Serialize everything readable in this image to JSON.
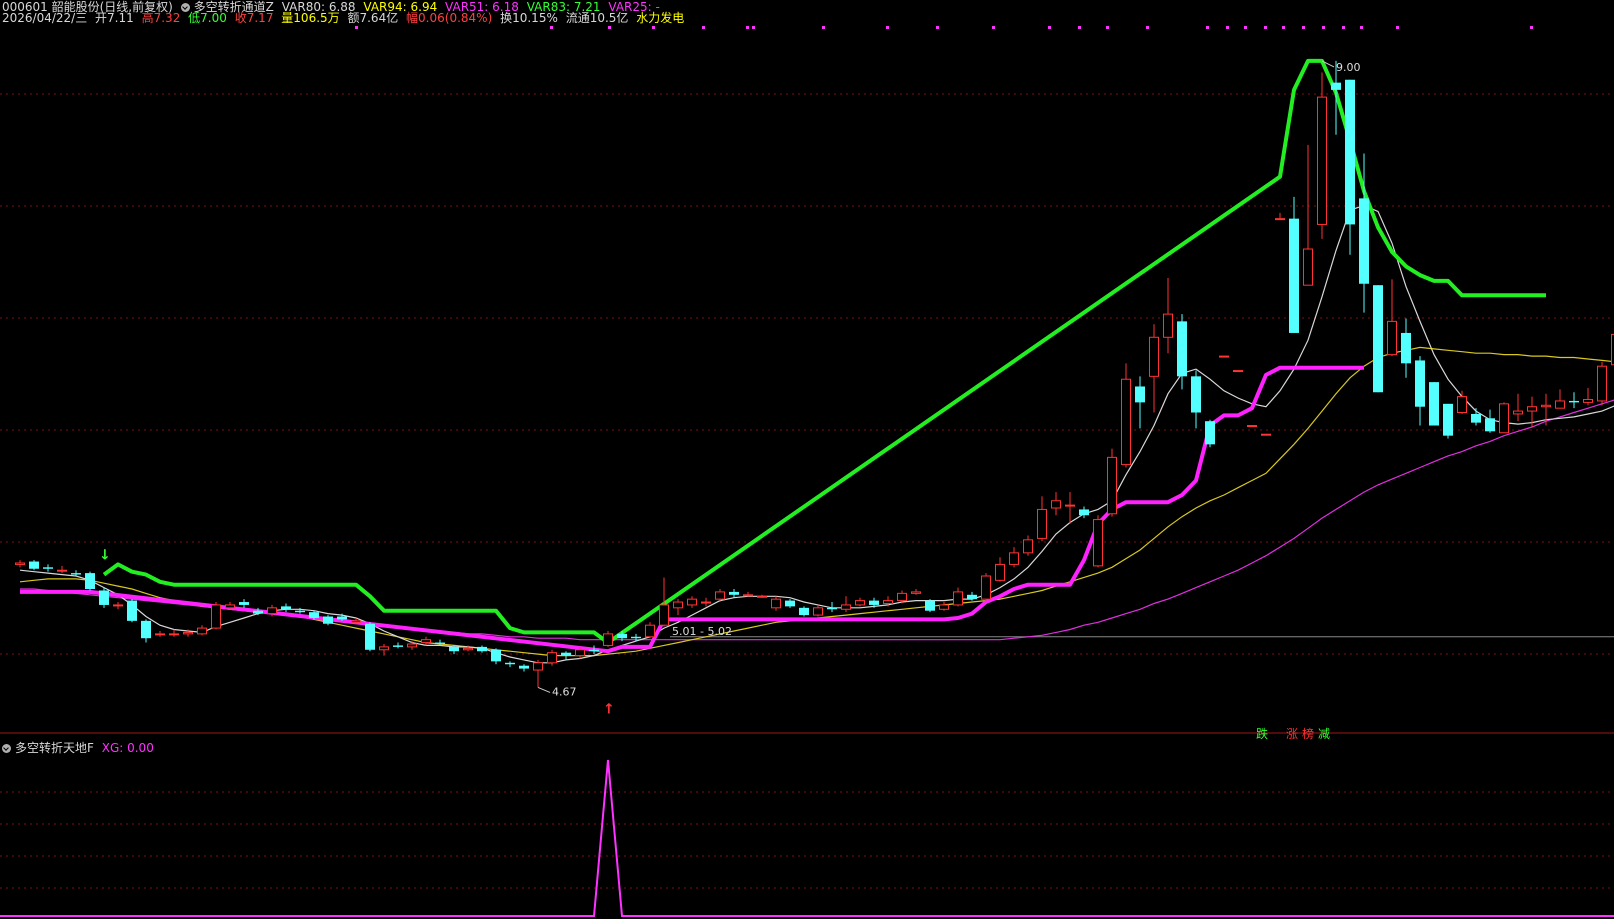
{
  "header": {
    "line1": {
      "stock": "000601 韶能股份(日线,前复权)",
      "indicator_name": "多空转折通道Z",
      "var80": "VAR80: 6.88",
      "var94": "VAR94: 6.94",
      "var51": "VAR51: 6.18",
      "var83": "VAR83: 7.21",
      "var25": "VAR25: -"
    },
    "line2": {
      "date": "2026/04/22/三",
      "open": "开7.11",
      "high": "高7.32",
      "low": "低7.00",
      "close": "收7.17",
      "volume": "量106.5万",
      "amount": "额7.64亿",
      "change": "幅0.06(0.84%)",
      "turnover": "换10.15%",
      "float_cap": "流通10.5亿",
      "concept": "水力发电"
    }
  },
  "sub_header": {
    "indicator_name": "多空转折天地F",
    "xg": "XG: 0.00"
  },
  "annotations": {
    "high_label": "9.00",
    "low_label": "4.67",
    "range_label": "5.01 - 5.02",
    "tag_fall": "跌",
    "tag_up": "涨",
    "tag_list": "榜",
    "tag_cut": "减"
  },
  "chart_data": {
    "type": "candlestick",
    "ylim": [
      4.5,
      9.2
    ],
    "colors": {
      "up": "#ff3333",
      "down": "#54ffff",
      "ma_white": "#d8d8d8",
      "ma_yellow": "#d8c820",
      "ma_magenta": "#e030e0",
      "channel_green": "#22ee22",
      "channel_magenta": "#ff22ff",
      "grid": "#7a1010"
    },
    "candles": [
      [
        5.52,
        5.53,
        5.55,
        5.5
      ],
      [
        5.54,
        5.49,
        5.55,
        5.48
      ],
      [
        5.5,
        5.49,
        5.52,
        5.47
      ],
      [
        5.48,
        5.48,
        5.51,
        5.46
      ],
      [
        5.46,
        5.45,
        5.48,
        5.44
      ],
      [
        5.46,
        5.35,
        5.47,
        5.34
      ],
      [
        5.34,
        5.24,
        5.36,
        5.22
      ],
      [
        5.24,
        5.24,
        5.26,
        5.21
      ],
      [
        5.27,
        5.13,
        5.28,
        5.12
      ],
      [
        5.13,
        5.01,
        5.14,
        4.98
      ],
      [
        5.04,
        5.04,
        5.06,
        5.02
      ],
      [
        5.04,
        5.04,
        5.07,
        5.02
      ],
      [
        5.04,
        5.05,
        5.07,
        5.02
      ],
      [
        5.04,
        5.08,
        5.1,
        5.03
      ],
      [
        5.08,
        5.24,
        5.26,
        5.07
      ],
      [
        5.22,
        5.24,
        5.26,
        5.21
      ],
      [
        5.26,
        5.24,
        5.28,
        5.22
      ],
      [
        5.2,
        5.18,
        5.22,
        5.17
      ],
      [
        5.18,
        5.22,
        5.24,
        5.16
      ],
      [
        5.23,
        5.21,
        5.25,
        5.19
      ],
      [
        5.2,
        5.19,
        5.22,
        5.18
      ],
      [
        5.19,
        5.15,
        5.2,
        5.14
      ],
      [
        5.16,
        5.11,
        5.17,
        5.1
      ],
      [
        5.16,
        5.14,
        5.18,
        5.13
      ],
      [
        5.12,
        5.13,
        5.15,
        5.11
      ],
      [
        5.11,
        4.93,
        5.12,
        4.92
      ],
      [
        4.93,
        4.95,
        4.97,
        4.89
      ],
      [
        4.96,
        4.95,
        4.98,
        4.94
      ],
      [
        4.95,
        4.97,
        4.99,
        4.93
      ],
      [
        4.98,
        5.0,
        5.02,
        4.96
      ],
      [
        4.98,
        4.97,
        5.0,
        4.96
      ],
      [
        4.95,
        4.92,
        4.96,
        4.9
      ],
      [
        4.93,
        4.94,
        4.96,
        4.92
      ],
      [
        4.95,
        4.92,
        4.96,
        4.91
      ],
      [
        4.93,
        4.85,
        4.94,
        4.83
      ],
      [
        4.84,
        4.83,
        4.85,
        4.81
      ],
      [
        4.82,
        4.8,
        4.83,
        4.78
      ],
      [
        4.79,
        4.84,
        4.86,
        4.67
      ],
      [
        4.84,
        4.91,
        4.93,
        4.82
      ],
      [
        4.91,
        4.89,
        4.92,
        4.86
      ],
      [
        4.89,
        4.93,
        4.95,
        4.87
      ],
      [
        4.93,
        4.92,
        4.96,
        4.9
      ],
      [
        4.96,
        5.04,
        5.06,
        4.95
      ],
      [
        5.04,
        5.01,
        5.06,
        4.99
      ],
      [
        5.02,
        5.01,
        5.04,
        4.99
      ],
      [
        5.02,
        5.1,
        5.12,
        5.01
      ],
      [
        5.1,
        5.24,
        5.43,
        5.09
      ],
      [
        5.22,
        5.26,
        5.28,
        5.17
      ],
      [
        5.24,
        5.28,
        5.3,
        5.22
      ],
      [
        5.26,
        5.26,
        5.29,
        5.23
      ],
      [
        5.28,
        5.33,
        5.35,
        5.26
      ],
      [
        5.33,
        5.31,
        5.35,
        5.29
      ],
      [
        5.31,
        5.31,
        5.33,
        5.3
      ],
      [
        5.3,
        5.3,
        5.31,
        5.29
      ],
      [
        5.22,
        5.28,
        5.3,
        5.2
      ],
      [
        5.27,
        5.23,
        5.28,
        5.22
      ],
      [
        5.22,
        5.17,
        5.23,
        5.16
      ],
      [
        5.17,
        5.22,
        5.24,
        5.16
      ],
      [
        5.22,
        5.21,
        5.26,
        5.19
      ],
      [
        5.21,
        5.24,
        5.3,
        5.19
      ],
      [
        5.24,
        5.27,
        5.29,
        5.23
      ],
      [
        5.27,
        5.24,
        5.29,
        5.22
      ],
      [
        5.25,
        5.27,
        5.3,
        5.23
      ],
      [
        5.27,
        5.32,
        5.34,
        5.25
      ],
      [
        5.32,
        5.33,
        5.35,
        5.31
      ],
      [
        5.27,
        5.2,
        5.28,
        5.19
      ],
      [
        5.21,
        5.24,
        5.26,
        5.2
      ],
      [
        5.24,
        5.33,
        5.36,
        5.23
      ],
      [
        5.31,
        5.28,
        5.33,
        5.27
      ],
      [
        5.28,
        5.44,
        5.46,
        5.27
      ],
      [
        5.41,
        5.52,
        5.57,
        5.4
      ],
      [
        5.52,
        5.6,
        5.64,
        5.5
      ],
      [
        5.6,
        5.69,
        5.72,
        5.58
      ],
      [
        5.7,
        5.9,
        5.99,
        5.68
      ],
      [
        5.91,
        5.96,
        6.02,
        5.86
      ],
      [
        5.93,
        5.93,
        6.02,
        5.8
      ],
      [
        5.9,
        5.86,
        5.92,
        5.84
      ],
      [
        5.51,
        5.83,
        5.86,
        5.5
      ],
      [
        5.87,
        6.26,
        6.32,
        5.85
      ],
      [
        6.21,
        6.8,
        6.91,
        6.19
      ],
      [
        6.75,
        6.64,
        6.82,
        6.46
      ],
      [
        6.82,
        7.09,
        7.18,
        6.57
      ],
      [
        7.09,
        7.25,
        7.5,
        6.98
      ],
      [
        7.2,
        6.82,
        7.25,
        6.73
      ],
      [
        6.82,
        6.57,
        6.86,
        6.46
      ],
      [
        6.51,
        6.35,
        6.52,
        6.33
      ],
      [
        6.96,
        6.96,
        6.96,
        6.96
      ],
      [
        6.86,
        6.86,
        6.86,
        6.86
      ],
      [
        6.48,
        6.48,
        6.48,
        6.48
      ],
      [
        6.42,
        6.42,
        6.42,
        6.42
      ],
      [
        7.91,
        7.91,
        7.95,
        7.91
      ],
      [
        7.91,
        7.12,
        8.06,
        7.12
      ],
      [
        7.45,
        7.7,
        8.42,
        7.45
      ],
      [
        7.87,
        8.75,
        8.92,
        7.77
      ],
      [
        8.85,
        8.8,
        9.0,
        8.49
      ],
      [
        8.87,
        7.87,
        8.87,
        7.66
      ],
      [
        8.05,
        7.46,
        8.36,
        7.26
      ],
      [
        7.45,
        6.71,
        7.45,
        6.71
      ],
      [
        6.97,
        7.2,
        7.49,
        6.96
      ],
      [
        7.12,
        6.91,
        7.22,
        6.81
      ],
      [
        6.93,
        6.61,
        6.96,
        6.48
      ],
      [
        6.78,
        6.48,
        6.78,
        6.48
      ],
      [
        6.63,
        6.41,
        6.63,
        6.39
      ],
      [
        6.57,
        6.68,
        6.72,
        6.56
      ],
      [
        6.56,
        6.5,
        6.6,
        6.48
      ],
      [
        6.53,
        6.44,
        6.59,
        6.43
      ],
      [
        6.43,
        6.63,
        6.64,
        6.43
      ],
      [
        6.56,
        6.58,
        6.7,
        6.51
      ],
      [
        6.58,
        6.61,
        6.68,
        6.47
      ],
      [
        6.61,
        6.62,
        6.7,
        6.48
      ],
      [
        6.6,
        6.65,
        6.73,
        6.6
      ],
      [
        6.65,
        6.64,
        6.71,
        6.6
      ],
      [
        6.64,
        6.66,
        6.74,
        6.62
      ],
      [
        6.65,
        6.89,
        6.92,
        6.62
      ],
      [
        6.9,
        7.11,
        7.26,
        6.79
      ],
      [
        7.11,
        7.17,
        7.32,
        7.0
      ]
    ],
    "ma_white": [
      5.48,
      5.47,
      5.46,
      5.45,
      5.44,
      5.41,
      5.36,
      5.31,
      5.24,
      5.16,
      5.1,
      5.07,
      5.06,
      5.05,
      5.09,
      5.12,
      5.15,
      5.18,
      5.2,
      5.21,
      5.21,
      5.2,
      5.18,
      5.17,
      5.15,
      5.11,
      5.06,
      5.02,
      4.98,
      4.96,
      4.96,
      4.95,
      4.95,
      4.94,
      4.91,
      4.88,
      4.86,
      4.84,
      4.84,
      4.86,
      4.87,
      4.89,
      4.93,
      4.96,
      4.99,
      5.02,
      5.08,
      5.12,
      5.17,
      5.22,
      5.27,
      5.29,
      5.3,
      5.3,
      5.3,
      5.29,
      5.26,
      5.24,
      5.22,
      5.22,
      5.22,
      5.23,
      5.24,
      5.26,
      5.27,
      5.27,
      5.27,
      5.28,
      5.28,
      5.31,
      5.36,
      5.42,
      5.5,
      5.61,
      5.73,
      5.81,
      5.87,
      5.9,
      5.96,
      6.14,
      6.3,
      6.48,
      6.7,
      6.84,
      6.87,
      6.8,
      6.72,
      6.67,
      6.63,
      6.61,
      6.72,
      6.87,
      7.07,
      7.37,
      7.69,
      7.97,
      8.0,
      7.96,
      7.74,
      7.44,
      7.2,
      6.97,
      6.8,
      6.68,
      6.58,
      6.52,
      6.5,
      6.49,
      6.5,
      6.52,
      6.53,
      6.54,
      6.56,
      6.58,
      6.62,
      6.69,
      6.78
    ],
    "ma_yellow": [
      5.4,
      5.41,
      5.42,
      5.42,
      5.42,
      5.41,
      5.39,
      5.37,
      5.35,
      5.32,
      5.29,
      5.27,
      5.25,
      5.23,
      5.22,
      5.21,
      5.2,
      5.19,
      5.18,
      5.17,
      5.16,
      5.14,
      5.12,
      5.1,
      5.08,
      5.06,
      5.04,
      5.02,
      5.0,
      4.98,
      4.97,
      4.96,
      4.95,
      4.94,
      4.93,
      4.92,
      4.91,
      4.9,
      4.89,
      4.89,
      4.89,
      4.89,
      4.9,
      4.91,
      4.92,
      4.94,
      4.96,
      4.98,
      5.0,
      5.02,
      5.04,
      5.06,
      5.08,
      5.1,
      5.12,
      5.13,
      5.14,
      5.15,
      5.16,
      5.17,
      5.18,
      5.19,
      5.2,
      5.21,
      5.22,
      5.23,
      5.24,
      5.25,
      5.26,
      5.27,
      5.28,
      5.3,
      5.32,
      5.34,
      5.37,
      5.4,
      5.43,
      5.46,
      5.5,
      5.56,
      5.62,
      5.7,
      5.78,
      5.85,
      5.91,
      5.96,
      6.0,
      6.05,
      6.1,
      6.15,
      6.25,
      6.35,
      6.46,
      6.58,
      6.7,
      6.81,
      6.89,
      6.95,
      6.98,
      7.0,
      7.02,
      7.01,
      7.0,
      6.99,
      6.98,
      6.98,
      6.97,
      6.97,
      6.96,
      6.96,
      6.95,
      6.95,
      6.94,
      6.93,
      6.92,
      6.9,
      6.88
    ],
    "ma_magenta": [
      5.35,
      5.35,
      5.34,
      5.33,
      5.32,
      5.31,
      5.3,
      5.29,
      5.28,
      5.27,
      5.26,
      5.25,
      5.24,
      5.23,
      5.22,
      5.21,
      5.2,
      5.19,
      5.18,
      5.17,
      5.16,
      5.15,
      5.14,
      5.13,
      5.12,
      5.11,
      5.1,
      5.09,
      5.08,
      5.07,
      5.06,
      5.05,
      5.04,
      5.04,
      5.03,
      5.02,
      5.02,
      5.01,
      5.01,
      5.01,
      5.0,
      5.0,
      5.0,
      5.0,
      5.0,
      5.0,
      5.0,
      5.0,
      5.0,
      5.0,
      5.0,
      5.0,
      5.0,
      5.0,
      5.0,
      5.0,
      5.0,
      5.0,
      5.0,
      5.0,
      5.0,
      5.0,
      5.0,
      5.0,
      5.0,
      5.0,
      5.0,
      5.0,
      5.0,
      5.0,
      5.0,
      5.01,
      5.02,
      5.03,
      5.05,
      5.07,
      5.1,
      5.12,
      5.15,
      5.18,
      5.21,
      5.25,
      5.28,
      5.32,
      5.36,
      5.4,
      5.44,
      5.48,
      5.53,
      5.58,
      5.64,
      5.7,
      5.77,
      5.84,
      5.9,
      5.96,
      6.02,
      6.07,
      6.11,
      6.15,
      6.19,
      6.23,
      6.27,
      6.3,
      6.34,
      6.37,
      6.41,
      6.44,
      6.47,
      6.51,
      6.54,
      6.57,
      6.6,
      6.63,
      6.66,
      6.7,
      6.73
    ],
    "channel_green": [
      [
        6,
        5.45
      ],
      [
        7,
        5.52
      ],
      [
        8,
        5.47
      ],
      [
        9,
        5.45
      ],
      [
        10,
        5.4
      ],
      [
        11,
        5.38
      ],
      [
        12,
        5.38
      ],
      [
        13,
        5.38
      ],
      [
        14,
        5.38
      ],
      [
        15,
        5.38
      ],
      [
        16,
        5.38
      ],
      [
        17,
        5.38
      ],
      [
        18,
        5.38
      ],
      [
        19,
        5.38
      ],
      [
        20,
        5.38
      ],
      [
        21,
        5.38
      ],
      [
        22,
        5.38
      ],
      [
        23,
        5.38
      ],
      [
        24,
        5.38
      ],
      [
        25,
        5.3
      ],
      [
        26,
        5.2
      ],
      [
        27,
        5.2
      ],
      [
        28,
        5.2
      ],
      [
        29,
        5.2
      ],
      [
        30,
        5.2
      ],
      [
        31,
        5.2
      ],
      [
        32,
        5.2
      ],
      [
        33,
        5.2
      ],
      [
        34,
        5.2
      ],
      [
        35,
        5.08
      ],
      [
        36,
        5.05
      ],
      [
        37,
        5.05
      ],
      [
        38,
        5.05
      ],
      [
        39,
        5.05
      ],
      [
        40,
        5.05
      ],
      [
        41,
        5.05
      ],
      [
        42,
        4.98
      ],
      [
        90,
        8.2
      ],
      [
        91,
        8.8
      ],
      [
        92,
        9.0
      ],
      [
        93,
        9.0
      ],
      [
        94,
        8.78
      ],
      [
        95,
        8.45
      ],
      [
        96,
        8.1
      ],
      [
        97,
        7.85
      ],
      [
        98,
        7.68
      ],
      [
        99,
        7.58
      ],
      [
        100,
        7.52
      ],
      [
        101,
        7.48
      ],
      [
        102,
        7.48
      ],
      [
        103,
        7.38
      ],
      [
        104,
        7.38
      ],
      [
        105,
        7.38
      ],
      [
        106,
        7.38
      ],
      [
        107,
        7.38
      ],
      [
        108,
        7.38
      ],
      [
        109,
        7.38
      ]
    ],
    "channel_magenta": [
      [
        0,
        5.33
      ],
      [
        1,
        5.33
      ],
      [
        2,
        5.33
      ],
      [
        3,
        5.33
      ],
      [
        4,
        5.33
      ],
      [
        5,
        5.33
      ],
      [
        42,
        4.92
      ],
      [
        43,
        4.95
      ],
      [
        44,
        4.95
      ],
      [
        45,
        4.95
      ],
      [
        46,
        5.14
      ],
      [
        47,
        5.14
      ],
      [
        48,
        5.14
      ],
      [
        49,
        5.14
      ],
      [
        50,
        5.14
      ],
      [
        51,
        5.14
      ],
      [
        52,
        5.14
      ],
      [
        53,
        5.14
      ],
      [
        54,
        5.14
      ],
      [
        55,
        5.14
      ],
      [
        56,
        5.14
      ],
      [
        57,
        5.14
      ],
      [
        58,
        5.14
      ],
      [
        59,
        5.14
      ],
      [
        60,
        5.14
      ],
      [
        61,
        5.14
      ],
      [
        62,
        5.14
      ],
      [
        63,
        5.14
      ],
      [
        64,
        5.14
      ],
      [
        65,
        5.14
      ],
      [
        66,
        5.14
      ],
      [
        67,
        5.15
      ],
      [
        68,
        5.18
      ],
      [
        69,
        5.26
      ],
      [
        70,
        5.3
      ],
      [
        71,
        5.35
      ],
      [
        72,
        5.38
      ],
      [
        73,
        5.38
      ],
      [
        74,
        5.38
      ],
      [
        75,
        5.38
      ],
      [
        76,
        5.55
      ],
      [
        77,
        5.8
      ],
      [
        78,
        5.9
      ],
      [
        79,
        5.95
      ],
      [
        80,
        5.95
      ],
      [
        81,
        5.95
      ],
      [
        82,
        5.95
      ],
      [
        83,
        6.0
      ],
      [
        84,
        6.1
      ],
      [
        85,
        6.48
      ],
      [
        86,
        6.55
      ],
      [
        87,
        6.55
      ],
      [
        88,
        6.6
      ],
      [
        89,
        6.83
      ],
      [
        90,
        6.88
      ],
      [
        91,
        6.88
      ],
      [
        92,
        6.88
      ],
      [
        93,
        6.88
      ],
      [
        94,
        6.88
      ],
      [
        95,
        6.88
      ],
      [
        96,
        6.88
      ]
    ],
    "hline": 5.02,
    "sub_signal": {
      "index": 42,
      "ylim": [
        0,
        1
      ],
      "value": 1
    }
  }
}
